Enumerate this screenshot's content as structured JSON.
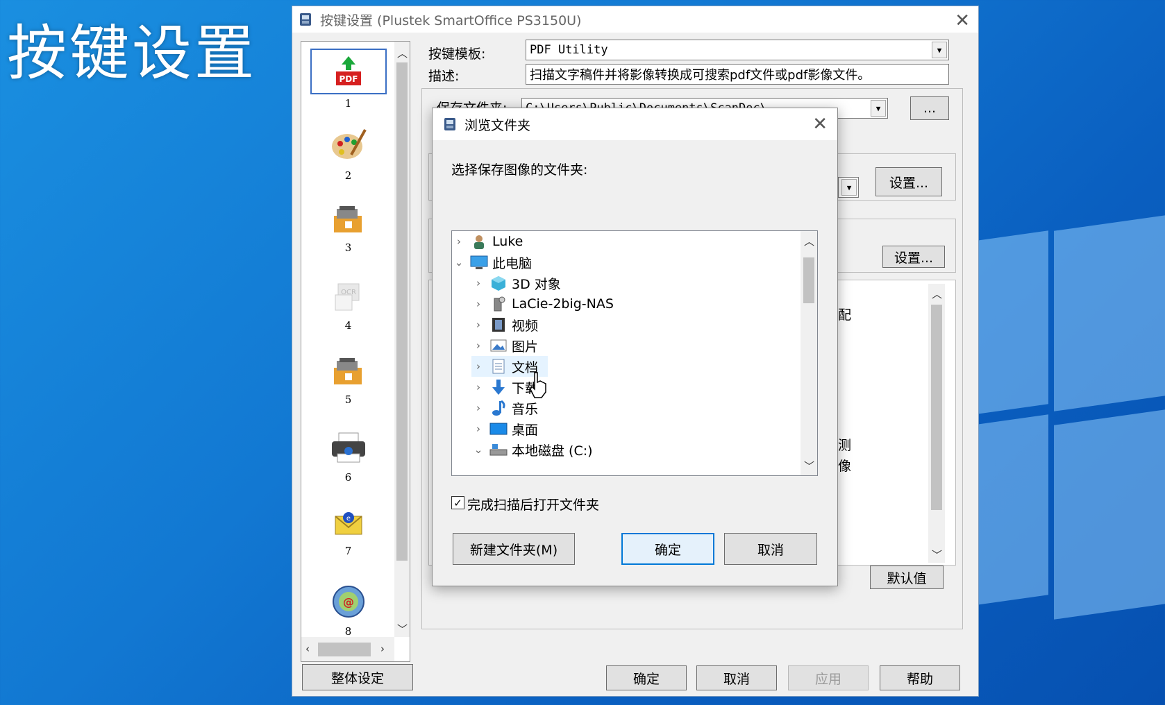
{
  "overlay_title": "按键设置",
  "main_window": {
    "title": "按键设置 (Plustek SmartOffice PS3150U)",
    "icon_items": [
      {
        "num": "1",
        "icon": "pdf-icon"
      },
      {
        "num": "2",
        "icon": "palette-icon"
      },
      {
        "num": "3",
        "icon": "scanner-folder-icon"
      },
      {
        "num": "4",
        "icon": "ocr-icon"
      },
      {
        "num": "5",
        "icon": "scanner-folder-icon"
      },
      {
        "num": "6",
        "icon": "printer-icon"
      },
      {
        "num": "7",
        "icon": "email-icon"
      },
      {
        "num": "8",
        "icon": "email-at-icon"
      }
    ],
    "template_label": "按键模板:",
    "template_value": "PDF Utility",
    "desc_label": "描述:",
    "desc_value": "扫描文字稿件并将影像转换成可搜索pdf文件或pdf影像文件。",
    "save_folder_label": "保存文件夹:",
    "save_folder_value": "C:\\Users\\Public\\Documents\\ScanDoc\\",
    "browse_label": "...",
    "settings_label_1": "设置...",
    "settings_label_2": "设置...",
    "partial_text_1": "配",
    "partial_text_2": "测",
    "partial_text_3": "像",
    "default_label": "默认值",
    "global_settings_label": "整体设定",
    "ok_label": "确定",
    "cancel_label": "取消",
    "apply_label": "应用",
    "help_label": "帮助"
  },
  "dialog": {
    "title": "浏览文件夹",
    "prompt": "选择保存图像的文件夹:",
    "tree": [
      {
        "label": "Luke",
        "icon": "user-icon",
        "chevron": "›",
        "level": 0
      },
      {
        "label": "此电脑",
        "icon": "computer-icon",
        "chevron": "⌄",
        "level": 0
      },
      {
        "label": "3D 对象",
        "icon": "cube-icon",
        "chevron": "›",
        "level": 1
      },
      {
        "label": "LaCie-2big-NAS",
        "icon": "nas-icon",
        "chevron": "›",
        "level": 1
      },
      {
        "label": "视频",
        "icon": "video-icon",
        "chevron": "›",
        "level": 1
      },
      {
        "label": "图片",
        "icon": "pictures-icon",
        "chevron": "›",
        "level": 1
      },
      {
        "label": "文档",
        "icon": "documents-icon",
        "chevron": "›",
        "level": 1
      },
      {
        "label": "下载",
        "icon": "download-icon",
        "chevron": "›",
        "level": 1
      },
      {
        "label": "音乐",
        "icon": "music-icon",
        "chevron": "›",
        "level": 1
      },
      {
        "label": "桌面",
        "icon": "desktop-icon",
        "chevron": "›",
        "level": 1
      },
      {
        "label": "本地磁盘 (C:)",
        "icon": "drive-icon",
        "chevron": "⌄",
        "level": 1
      }
    ],
    "checkbox_label": "完成扫描后打开文件夹",
    "checkbox_checked": true,
    "new_folder_label": "新建文件夹(M)",
    "ok_label": "确定",
    "cancel_label": "取消"
  }
}
